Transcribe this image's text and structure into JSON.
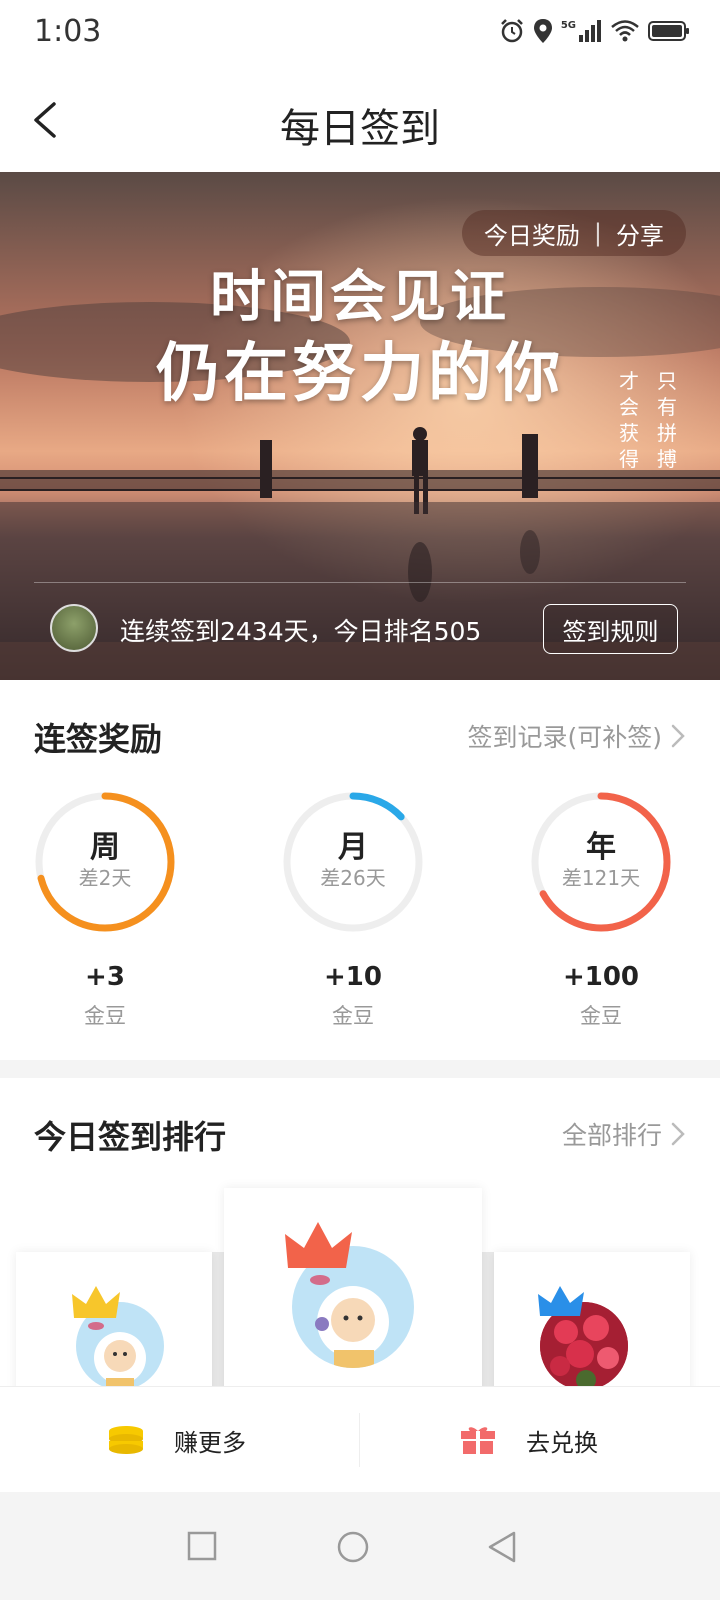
{
  "status_bar": {
    "time": "1:03",
    "network": "5G"
  },
  "nav": {
    "title": "每日签到",
    "back_icon": "chevron-left-icon"
  },
  "banner": {
    "pill_reward": "今日奖励",
    "pill_separator": "|",
    "pill_share": "分享",
    "slogan_line1": "时间会见证",
    "slogan_line2": "仍在努力的你",
    "vertical_col_right": "只有拼搏",
    "vertical_col_left": "才会获得",
    "streak_text": "连续签到2434天，今日排名505",
    "rules_button": "签到规则"
  },
  "streak_rewards": {
    "title": "连签奖励",
    "link": "签到记录(可补签)",
    "items": [
      {
        "label": "周",
        "remaining": "差2天",
        "reward": "+3",
        "unit": "金豆",
        "progress": 0.71,
        "color": "#f5901e"
      },
      {
        "label": "月",
        "remaining": "差26天",
        "reward": "+10",
        "unit": "金豆",
        "progress": 0.13,
        "color": "#2aa8e8"
      },
      {
        "label": "年",
        "remaining": "差121天",
        "reward": "+100",
        "unit": "金豆",
        "progress": 0.67,
        "color": "#f2634a"
      }
    ]
  },
  "ranking": {
    "title": "今日签到排行",
    "link": "全部排行",
    "crown_colors": {
      "first": "#f2634a",
      "second": "#f7c62b",
      "third": "#2a8fe8"
    }
  },
  "bottom_bar": {
    "earn_label": "赚更多",
    "exchange_label": "去兑换",
    "earn_icon": "coin-stack-icon",
    "exchange_icon": "gift-icon"
  },
  "system_nav": {
    "recent_icon": "square-icon",
    "home_icon": "circle-icon",
    "back_icon": "triangle-back-icon"
  }
}
